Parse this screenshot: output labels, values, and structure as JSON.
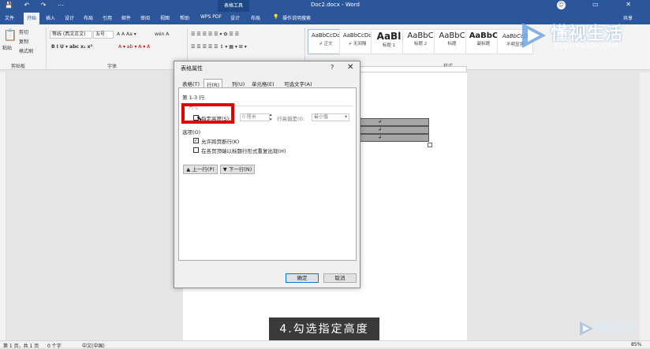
{
  "titlebar": {
    "quick_access": "💾 ↶ ↷ ⋯",
    "context_tab": "表格工具",
    "document_title": "Doc2.docx - Word",
    "window_controls": "— ▭ ✕"
  },
  "menu": {
    "items": [
      "文件",
      "开始",
      "插入",
      "设计",
      "布局",
      "引用",
      "邮件",
      "审阅",
      "视图",
      "帮助",
      "WPS PDF",
      "设计",
      "布局"
    ],
    "tell_me": "操作说明搜索",
    "share": "共享"
  },
  "ribbon": {
    "clipboard": {
      "paste": "粘贴",
      "cut": "剪切",
      "copy": "复制",
      "format_painter": "格式刷",
      "group_label": "剪贴板"
    },
    "font": {
      "font_name": "等线 (西文正文)",
      "font_size": "五号",
      "aa": "A A Aa ▾",
      "wen": "wén A",
      "buttons": "B I U ▾ abc x₂ x²",
      "effects": "A ▾ ab ▾ A ▾ A",
      "group_label": "字体"
    },
    "paragraph": {
      "row1": "☰ ☰ ☰ ☰ ☰ ▾ ✿ ☰ ☰",
      "row2": "☰ ☰ ☰ ☰ ☰ ↕ ▾ ▦ ▾ ⊞ ▾",
      "group_label": "段落"
    },
    "styles": {
      "items": [
        {
          "sample": "AaBbCcDc",
          "name": "↲ 正文"
        },
        {
          "sample": "AaBbCcDc",
          "name": "↲ 无间隔"
        },
        {
          "sample": "AaBl",
          "name": "标题 1"
        },
        {
          "sample": "AaBbC",
          "name": "标题 2"
        },
        {
          "sample": "AaBbC",
          "name": "标题"
        },
        {
          "sample": "AaBbC",
          "name": "副标题"
        },
        {
          "sample": "AaBbCcD",
          "name": "不明显强"
        }
      ],
      "group_label": "样式"
    }
  },
  "logo": {
    "cn": "懂视生活",
    "en": "51DONGSHI.COM"
  },
  "table_cells": [
    "↲",
    "↲",
    "↲"
  ],
  "dialog": {
    "title": "表格属性",
    "help": "?",
    "close": "✕",
    "tabs": [
      "表格(T)",
      "行(R)",
      "列(U)",
      "单元格(E)",
      "可选文字(A)"
    ],
    "selected_tab": 1,
    "rows_label": "第 1-3 行:",
    "size_label": "尺寸",
    "specify_height": "指定高度(S):",
    "height_value": "0 厘米",
    "height_rule_label": "行高值是(I):",
    "height_rule_value": "最小值",
    "options_label": "选项(O)",
    "allow_break": "允许跨页断行(K)",
    "repeat_header": "在各页顶端以标题行形式重复出现(H)",
    "prev_row": "▲ 上一行(P)",
    "next_row": "▼ 下一行(N)",
    "ok": "确定",
    "cancel": "取消",
    "specify_height_checked": false,
    "allow_break_checked": true,
    "repeat_header_checked": false
  },
  "caption": "4.勾选指定高度",
  "status": {
    "page": "第 1 页，共 1 页",
    "words": "0 个字",
    "lang": "中文(中国)",
    "zoom": "85%"
  },
  "colors": {
    "title_blue": "#2b579a",
    "highlight_red": "#e00000"
  }
}
